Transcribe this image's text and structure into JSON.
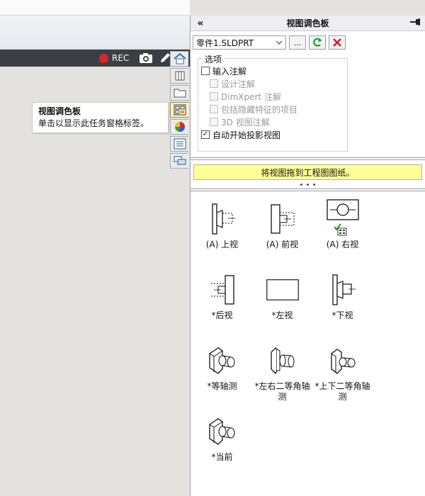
{
  "toolbar": {
    "rec_label": "REC",
    "rec_color": "#e0242b"
  },
  "tooltip": {
    "title": "视图调色板",
    "body": "单击以显示此任务窗格标签。"
  },
  "panel": {
    "title": "视图调色板",
    "collapse_glyph": "«",
    "document": "零件1.SLDPRT",
    "browse_label": "...",
    "options_legend": "选项",
    "options": {
      "import_annotations": "输入注解",
      "design_annotations": "设计注解",
      "dimxpert_annotations": "DimXpert 注解",
      "hidden_features": "包括隐藏特征的项目",
      "3d_view_annotations": "3D 视图注解",
      "auto_start_projected": "自动开始投影视图"
    },
    "banner": "将视图拖到工程图图纸。",
    "banner_color": "#ffff9a",
    "views": [
      {
        "label": "(A) 上视",
        "icon": "top-view-icon"
      },
      {
        "label": "(A) 前视",
        "icon": "front-view-icon"
      },
      {
        "label": "(A) 右视",
        "icon": "right-view-icon"
      },
      {
        "label": "*后视",
        "icon": "back-view-icon"
      },
      {
        "label": "*左视",
        "icon": "left-view-icon"
      },
      {
        "label": "*下视",
        "icon": "bottom-view-icon"
      },
      {
        "label": "*等轴测",
        "icon": "isometric-view-icon"
      },
      {
        "label": "*左右二等角轴测",
        "icon": "dimetric-lr-view-icon"
      },
      {
        "label": "*上下二等角轴测",
        "icon": "dimetric-tb-view-icon"
      },
      {
        "label": "*当前",
        "icon": "current-view-icon"
      }
    ]
  }
}
